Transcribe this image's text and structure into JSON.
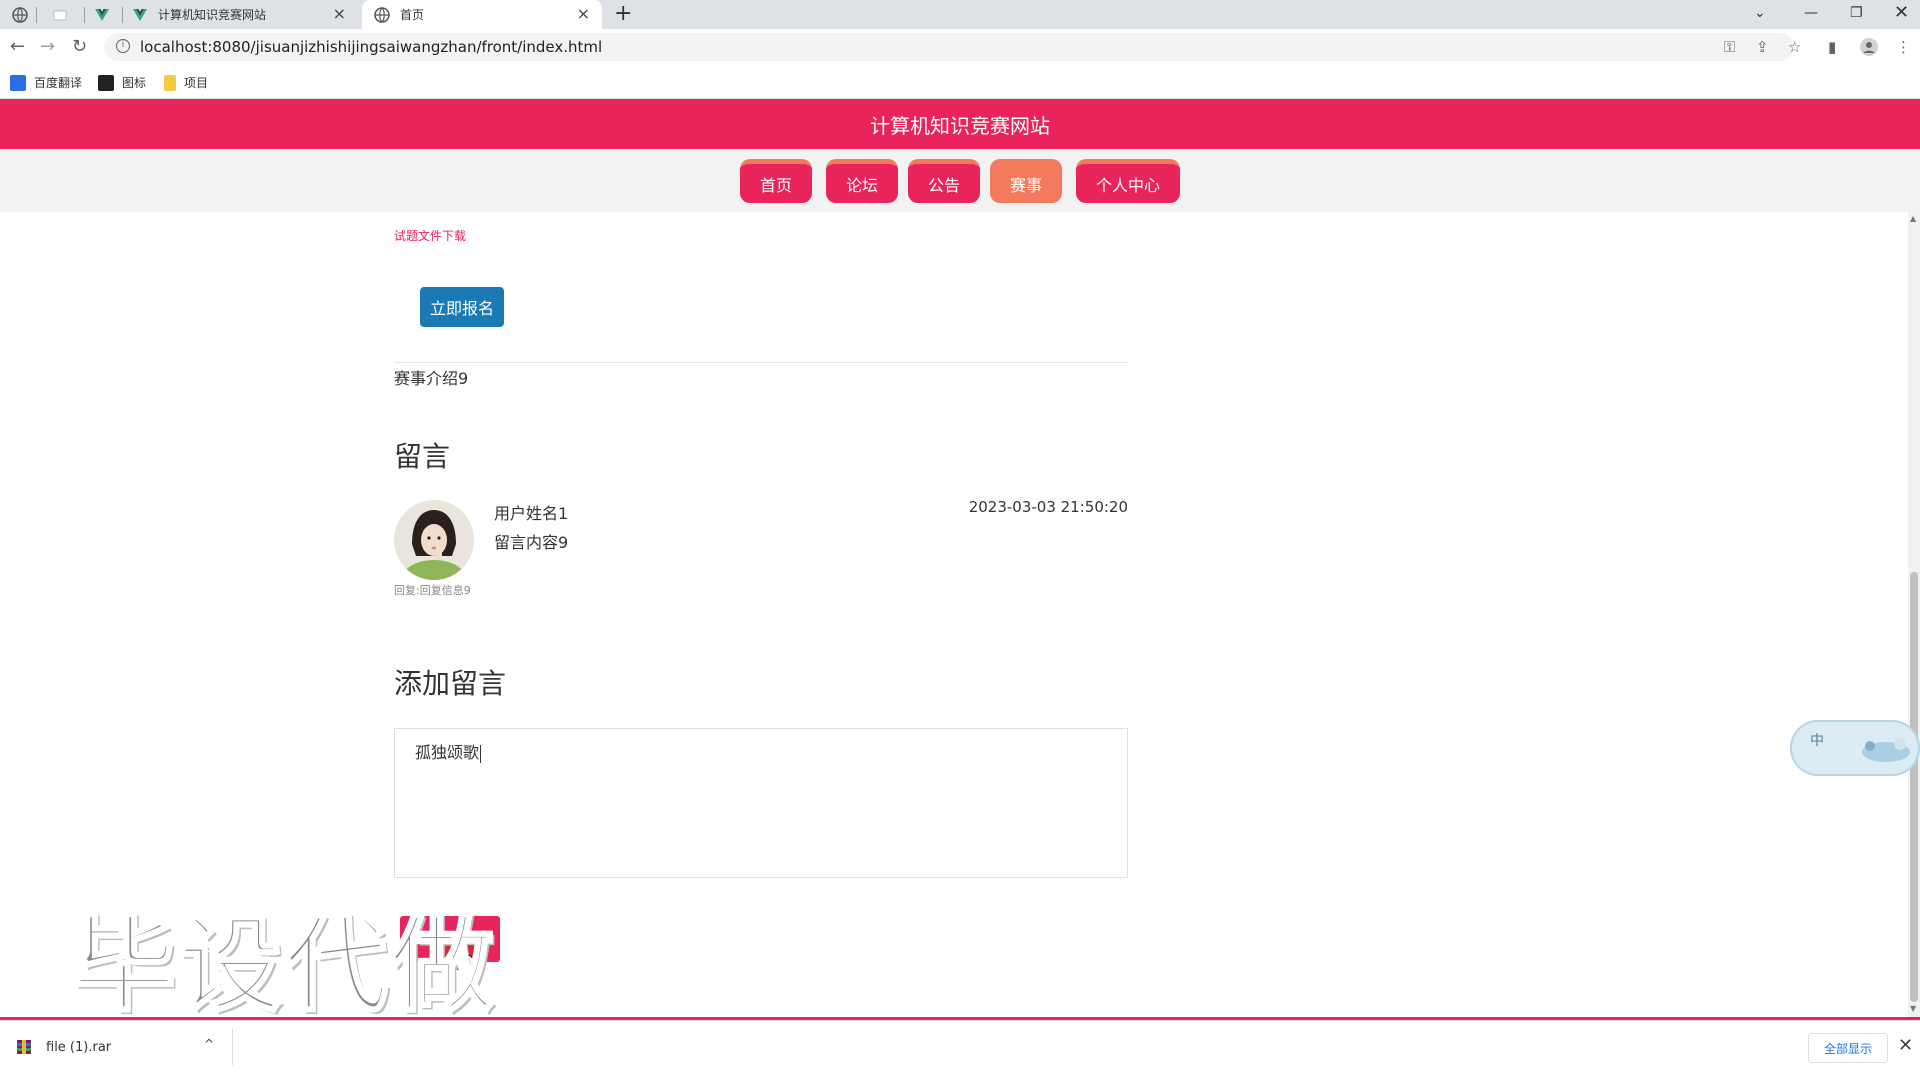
{
  "browser": {
    "tabs": [
      {
        "title": "",
        "type": "globe"
      },
      {
        "title": "",
        "type": "blank"
      },
      {
        "title": "",
        "type": "vue"
      },
      {
        "title": "计算机知识竞赛网站",
        "type": "vue"
      },
      {
        "title": "首页",
        "type": "globe",
        "active": true
      }
    ],
    "new_tab": "+",
    "url": "localhost:8080/jisuanjizhishijingsaiwangzhan/front/index.html",
    "bookmarks": [
      "百度翻译",
      "图标",
      "项目"
    ]
  },
  "site": {
    "title": "计算机知识竞赛网站",
    "nav": [
      {
        "label": "首页",
        "active": false
      },
      {
        "label": "论坛",
        "active": false
      },
      {
        "label": "公告",
        "active": false
      },
      {
        "label": "赛事",
        "active": true
      },
      {
        "label": "个人中心",
        "active": false
      }
    ]
  },
  "content": {
    "download_link": "试题文件下载",
    "signup_button": "立即报名",
    "intro": "赛事介绍9",
    "messages_heading": "留言",
    "message": {
      "user": "用户姓名1",
      "text": "留言内容9",
      "time": "2023-03-03 21:50:20",
      "reply_prefix": "回复:",
      "reply": "回复信息9"
    },
    "add_heading": "添加留言",
    "textarea_value": "孤独颂歌"
  },
  "watermark": "毕设代做",
  "ime": {
    "label": "中"
  },
  "download_bar": {
    "file": "file (1).rar",
    "show_all": "全部显示"
  },
  "colors": {
    "brand": "#e8245a",
    "accent": "#f47a5e",
    "signup": "#1b7ab3"
  }
}
